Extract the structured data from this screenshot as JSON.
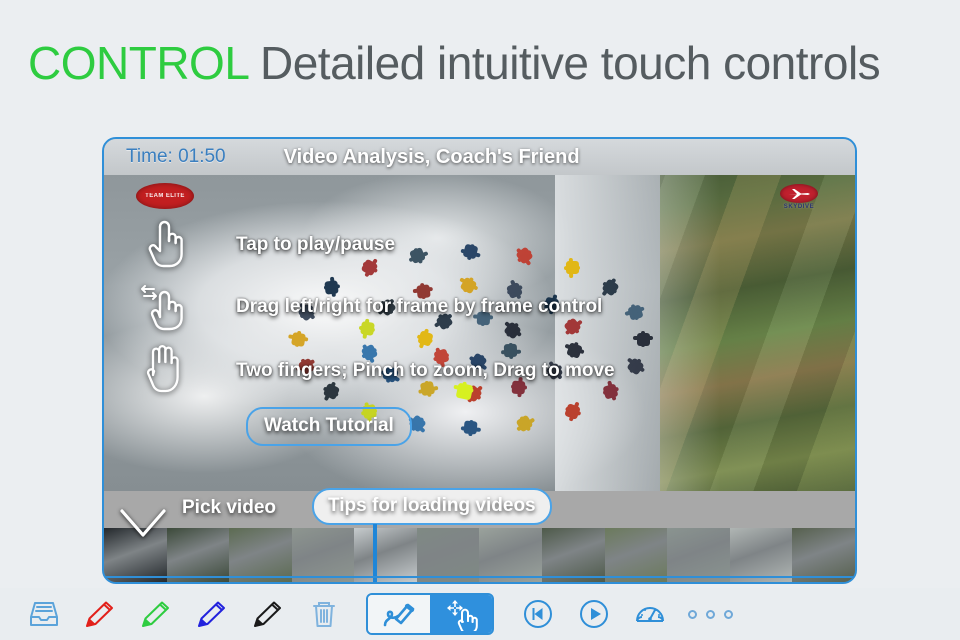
{
  "headline": {
    "keyword": "CONTROL",
    "rest": "Detailed intuitive touch controls",
    "keyword_color": "#2ecc40",
    "rest_color": "#555c60"
  },
  "app": {
    "title_bar": {
      "time_label": "Time:  01:50",
      "app_title": "Video Analysis, Coach's Friend"
    },
    "video": {
      "logo_left": "TEAM ELITE",
      "logo_right": "SKYDIVE",
      "hints": [
        {
          "icon": "one-finger-tap-icon",
          "text": "Tap to play/pause"
        },
        {
          "icon": "finger-drag-horizontal-icon",
          "text": "Drag left/right for frame by frame control"
        },
        {
          "icon": "two-finger-pinch-icon",
          "text": "Two fingers; Pinch to zoom, Drag to move"
        }
      ],
      "watch_tutorial_label": "Watch Tutorial"
    },
    "timeline": {
      "pick_video_label": "Pick video",
      "tips_label": "Tips for loading videos",
      "thumbnails": [
        "#23282c",
        "#3c4a3a",
        "#5c6b52",
        "#8e9690",
        "#c6cbcd",
        "#7f8a84",
        "#9aa29c",
        "#4e5a4a",
        "#6b7a5c",
        "#8a9490",
        "#b0b6b4",
        "#56604e"
      ]
    }
  },
  "toolbar": {
    "items": [
      {
        "name": "inbox-tray-icon",
        "kind": "tray",
        "color": "#5ba3da"
      },
      {
        "name": "pencil-red-icon",
        "kind": "pencil",
        "color": "#e2201a"
      },
      {
        "name": "pencil-green-icon",
        "kind": "pencil",
        "color": "#2ecc40"
      },
      {
        "name": "pencil-blue-icon",
        "kind": "pencil",
        "color": "#2222dd"
      },
      {
        "name": "pencil-black-icon",
        "kind": "pencil",
        "color": "#1a1a1a"
      },
      {
        "name": "trash-icon",
        "kind": "trash",
        "color": "#7fb3de"
      }
    ],
    "segmented": [
      {
        "name": "draw-mode-button",
        "icon": "scribble-pen-icon",
        "active": false
      },
      {
        "name": "move-mode-button",
        "icon": "move-hand-icon",
        "active": true
      }
    ],
    "transport": [
      {
        "name": "skip-to-start-button",
        "icon": "skip-back-icon"
      },
      {
        "name": "play-button",
        "icon": "play-icon"
      },
      {
        "name": "playback-speed-button",
        "icon": "speed-gauge-icon"
      }
    ],
    "more_label": "more-options"
  },
  "colors": {
    "page_bg": "#ebeef1",
    "accent_blue": "#2f8fd8",
    "toolbar_bg": "#e9edf0",
    "grey_bar": "#a8a8a8"
  }
}
